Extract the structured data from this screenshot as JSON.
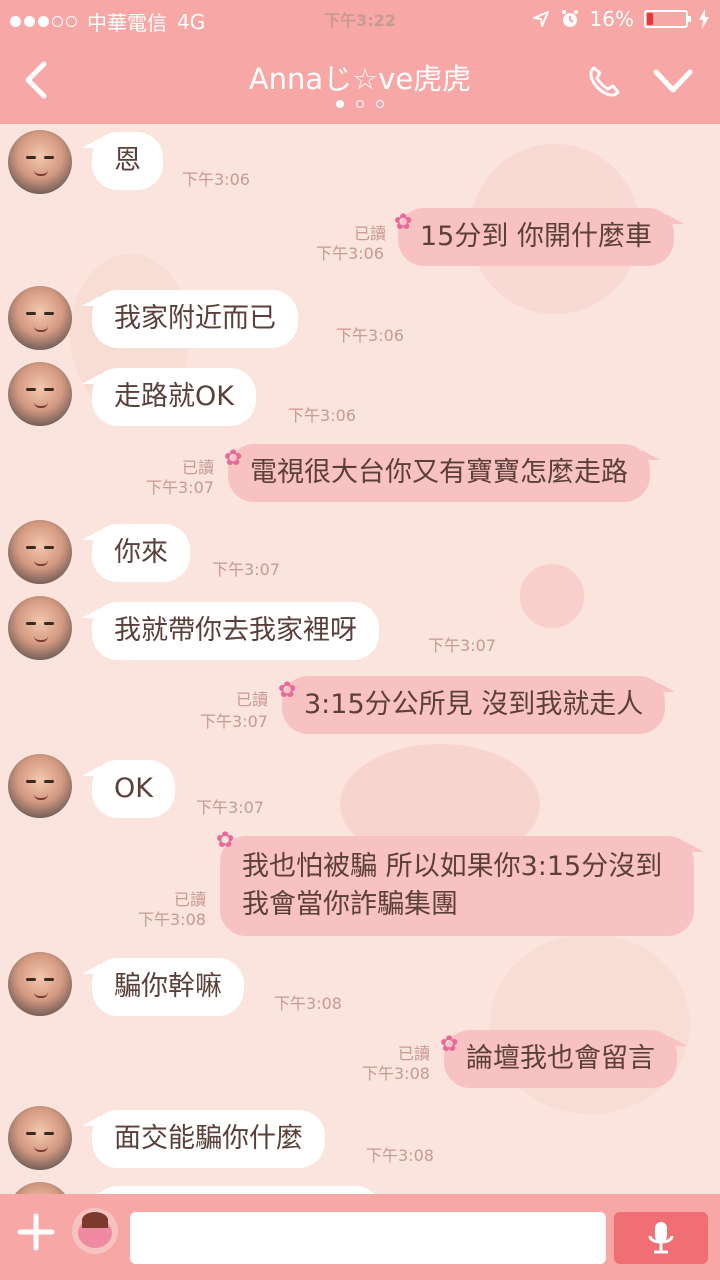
{
  "status_bar": {
    "carrier": "中華電信",
    "network": "4G",
    "time": "下午3:22",
    "battery": "16%",
    "battery_level": 0.16
  },
  "header": {
    "title": "Annaじ☆ve虎虎",
    "page_count": 3,
    "active_page": 1
  },
  "messages": [
    {
      "side": "in",
      "text": "恩",
      "time": "下午3:06"
    },
    {
      "side": "out",
      "text": "15分到 你開什麼車",
      "time": "下午3:06",
      "read": "已讀"
    },
    {
      "side": "in",
      "text": "我家附近而已",
      "time": "下午3:06"
    },
    {
      "side": "in",
      "text": "走路就OK",
      "time": "下午3:06"
    },
    {
      "side": "out",
      "text": "電視很大台你又有寶寶怎麼走路",
      "time": "下午3:07",
      "read": "已讀"
    },
    {
      "side": "in",
      "text": "你來",
      "time": "下午3:07"
    },
    {
      "side": "in",
      "text": "我就帶你去我家裡呀",
      "time": "下午3:07"
    },
    {
      "side": "out",
      "text": "3:15分公所見 沒到我就走人",
      "time": "下午3:07",
      "read": "已讀"
    },
    {
      "side": "in",
      "text": "OK",
      "time": "下午3:07"
    },
    {
      "side": "out",
      "text": "我也怕被騙 所以如果你3:15分沒到我會當你詐騙集團",
      "time": "下午3:08",
      "read": "已讀"
    },
    {
      "side": "in",
      "text": "騙你幹嘛",
      "time": "下午3:08"
    },
    {
      "side": "out",
      "text": "論壇我也會留言",
      "time": "下午3:08",
      "read": "已讀"
    },
    {
      "side": "in",
      "text": "面交能騙你什麼",
      "time": "下午3:08"
    }
  ],
  "input": {
    "placeholder": "",
    "value": ""
  },
  "colors": {
    "header_bg": "#f7a7a5",
    "chat_bg": "#fbe3de",
    "out_bubble": "#f9c2c2",
    "mic_btn": "#ef6f74"
  }
}
